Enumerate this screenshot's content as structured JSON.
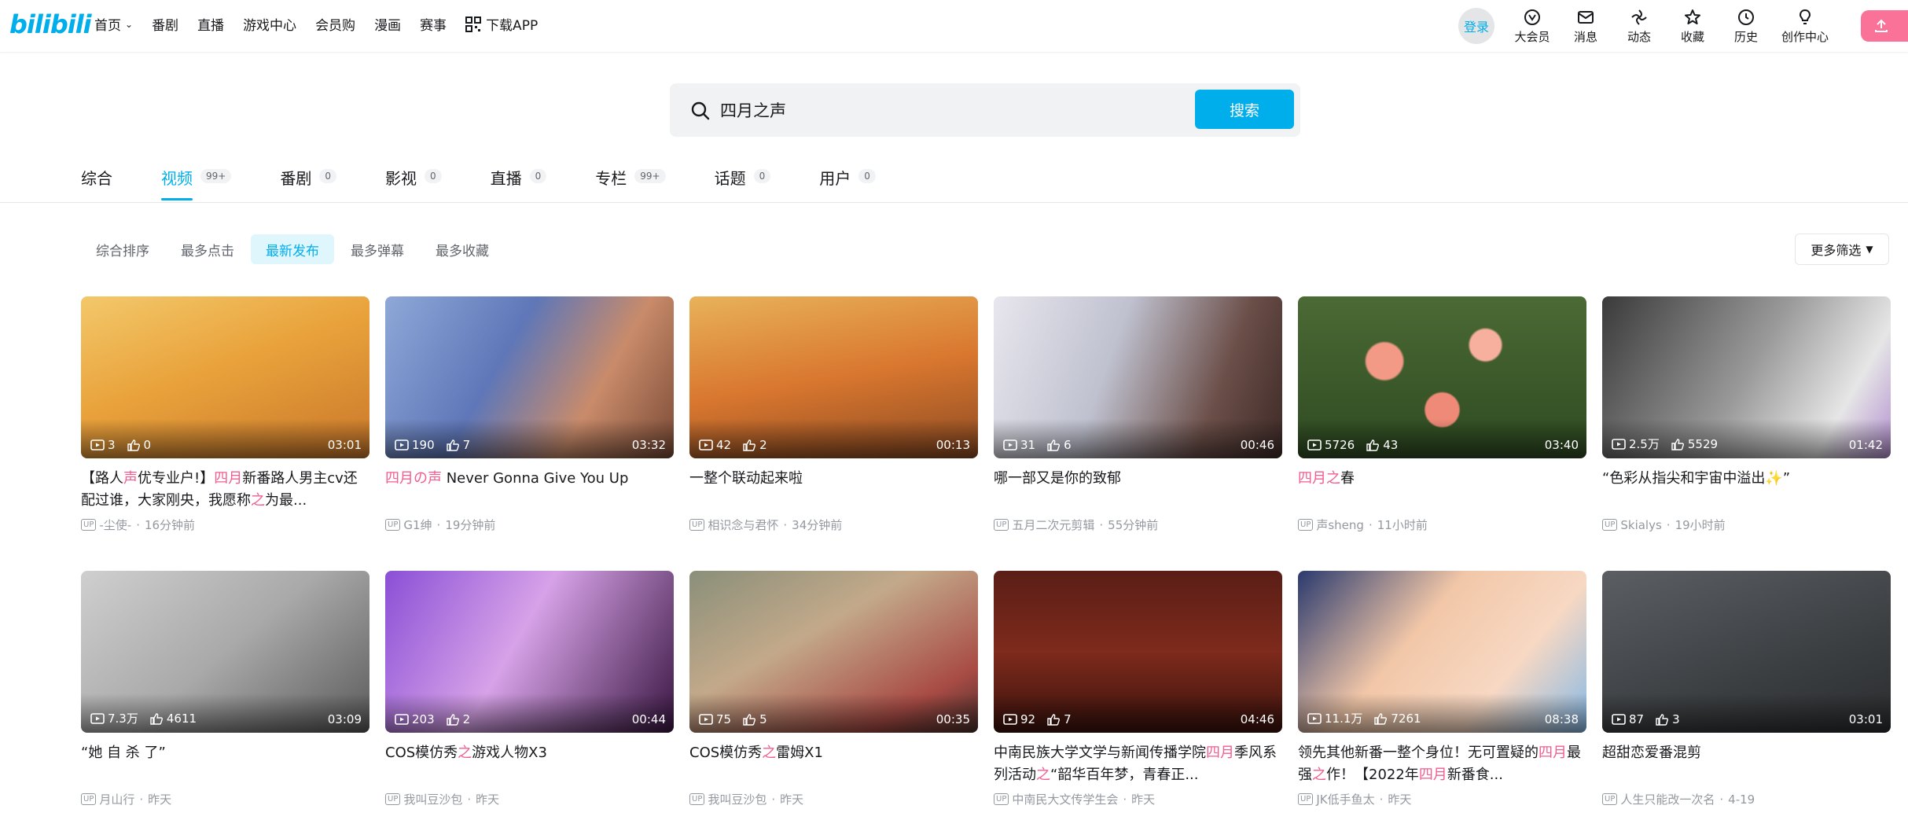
{
  "header": {
    "logo": "bilibili",
    "nav": [
      {
        "label": "首页",
        "dropdown": true
      },
      {
        "label": "番剧"
      },
      {
        "label": "直播"
      },
      {
        "label": "游戏中心"
      },
      {
        "label": "会员购"
      },
      {
        "label": "漫画"
      },
      {
        "label": "赛事"
      },
      {
        "label": "下载APP",
        "icon": "qrcode-icon"
      }
    ],
    "login": "登录",
    "right": [
      {
        "label": "大会员",
        "icon": "vip-icon"
      },
      {
        "label": "消息",
        "icon": "mail-icon"
      },
      {
        "label": "动态",
        "icon": "dynamic-icon"
      },
      {
        "label": "收藏",
        "icon": "star-icon"
      },
      {
        "label": "历史",
        "icon": "clock-icon"
      },
      {
        "label": "创作中心",
        "icon": "bulb-icon"
      }
    ],
    "upload_icon": "upload-icon"
  },
  "search": {
    "value": "四月之声",
    "button": "搜索"
  },
  "tabs": [
    {
      "label": "综合",
      "badge": ""
    },
    {
      "label": "视频",
      "badge": "99+",
      "active": true
    },
    {
      "label": "番剧",
      "badge": "0"
    },
    {
      "label": "影视",
      "badge": "0"
    },
    {
      "label": "直播",
      "badge": "0"
    },
    {
      "label": "专栏",
      "badge": "99+"
    },
    {
      "label": "话题",
      "badge": "0"
    },
    {
      "label": "用户",
      "badge": "0"
    }
  ],
  "sort": {
    "options": [
      "综合排序",
      "最多点击",
      "最新发布",
      "最多弹幕",
      "最多收藏"
    ],
    "active_index": 2,
    "more_filter": "更多筛选"
  },
  "colors": {
    "accent": "#00aeec",
    "highlight": "#f25d8e",
    "pink": "#fb7299"
  },
  "videos": [
    {
      "title_parts": [
        [
          "【路人",
          0
        ],
        [
          "声",
          1
        ],
        [
          "优专业户!】",
          0
        ],
        [
          "四月",
          1
        ],
        [
          "新番路人男主cv还配过谁，大家刚央，我愿称",
          0
        ],
        [
          "之",
          1
        ],
        [
          "为最...",
          0
        ]
      ],
      "views": "3",
      "likes": "0",
      "duration": "03:01",
      "uploader": "-尘使-",
      "time": "16分钟前",
      "theme": "anime-boy"
    },
    {
      "title_parts": [
        [
          "四月の声",
          1
        ],
        [
          " Never Gonna Give You Up",
          0
        ]
      ],
      "views": "190",
      "likes": "7",
      "duration": "03:32",
      "uploader": "G1绅",
      "time": "19分钟前",
      "theme": "singer"
    },
    {
      "title_parts": [
        [
          "一整个联动起来啦",
          0
        ]
      ],
      "views": "42",
      "likes": "2",
      "duration": "00:13",
      "uploader": "相识念与君怀",
      "time": "34分钟前",
      "theme": "autumn"
    },
    {
      "title_parts": [
        [
          "哪一部又是你的致郁",
          0
        ]
      ],
      "views": "31",
      "likes": "6",
      "duration": "00:46",
      "uploader": "五月二次元剪辑",
      "time": "55分钟前",
      "theme": "kiss"
    },
    {
      "title_parts": [
        [
          "四月之",
          1
        ],
        [
          "春",
          0
        ]
      ],
      "views": "5726",
      "likes": "43",
      "duration": "03:40",
      "uploader": "声sheng",
      "time": "11小时前",
      "theme": "roses"
    },
    {
      "title_parts": [
        [
          "“色彩从指尖和宇宙中溢出✨”",
          0
        ]
      ],
      "views": "2.5万",
      "likes": "5529",
      "duration": "01:42",
      "uploader": "Skialys",
      "time": "19小时前",
      "theme": "mono-girl"
    },
    {
      "title_parts": [
        [
          "“她 自 杀 了”",
          0
        ]
      ],
      "views": "7.3万",
      "likes": "4611",
      "duration": "03:09",
      "uploader": "月山行",
      "time": "昨天",
      "theme": "grey-sketch"
    },
    {
      "title_parts": [
        [
          "COS模仿秀",
          0
        ],
        [
          "之",
          1
        ],
        [
          "游戏人物X3",
          0
        ]
      ],
      "views": "203",
      "likes": "2",
      "duration": "00:44",
      "uploader": "我叫豆沙包",
      "time": "昨天",
      "theme": "cos-purple"
    },
    {
      "title_parts": [
        [
          "COS模仿秀",
          0
        ],
        [
          "之",
          1
        ],
        [
          "雷姆X1",
          0
        ]
      ],
      "views": "75",
      "likes": "5",
      "duration": "00:35",
      "uploader": "我叫豆沙包",
      "time": "昨天",
      "theme": "cos-rem"
    },
    {
      "title_parts": [
        [
          "中南民族大学文学与新闻传播学院",
          0
        ],
        [
          "四月",
          1
        ],
        [
          "季风系列活动",
          0
        ],
        [
          "之",
          1
        ],
        [
          "“韶华百年梦，青春正...",
          0
        ]
      ],
      "views": "92",
      "likes": "7",
      "duration": "04:46",
      "uploader": "中南民大文传学生会",
      "time": "昨天",
      "theme": "stage"
    },
    {
      "title_parts": [
        [
          "领先其他新番一整个身位！无可置疑的",
          0
        ],
        [
          "四月",
          1
        ],
        [
          "最强",
          0
        ],
        [
          "之",
          1
        ],
        [
          "作！【2022年",
          0
        ],
        [
          "四月",
          1
        ],
        [
          "新番食...",
          0
        ]
      ],
      "views": "11.1万",
      "likes": "7261",
      "duration": "08:38",
      "uploader": "JK低手鱼太",
      "time": "昨天",
      "theme": "anime-eyes"
    },
    {
      "title_parts": [
        [
          "超甜恋爱番混剪",
          0
        ]
      ],
      "views": "87",
      "likes": "3",
      "duration": "03:01",
      "uploader": "人生只能改一次名",
      "time": "4-19",
      "theme": "dark-cloud"
    }
  ]
}
